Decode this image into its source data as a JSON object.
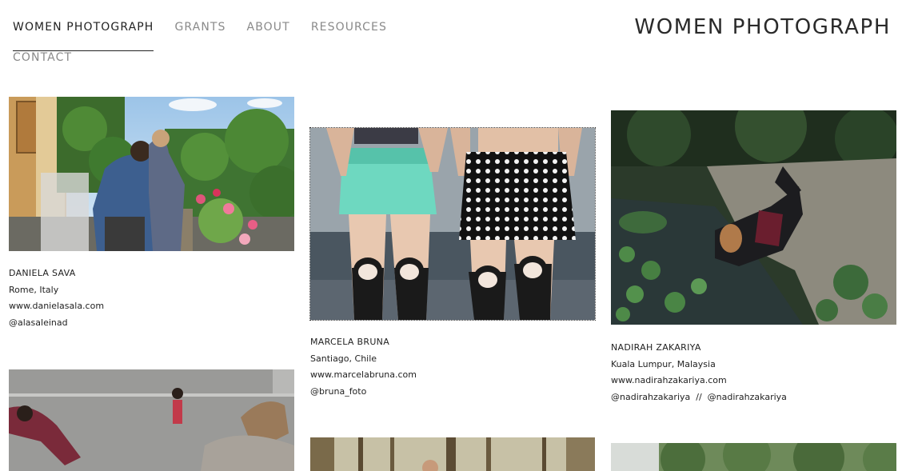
{
  "nav": {
    "items": [
      "WOMEN PHOTOGRAPH",
      "GRANTS",
      "ABOUT",
      "RESOURCES",
      "CONTACT"
    ],
    "active_index": 0
  },
  "site_title": "WOMEN PHOTOGRAPH",
  "photographers": [
    {
      "name": "DANIELA SAVA",
      "location": "Rome, Italy",
      "website": "www.danielasala.com",
      "social": "@alasaleinad"
    },
    {
      "name": "MARCELA BRUNA",
      "location": "Santiago, Chile",
      "website": "www.marcelabruna.com",
      "social": "@bruna_foto"
    },
    {
      "name": "NADIRAH ZAKARIYA",
      "location": "Kuala Lumpur, Malaysia",
      "website": "www.nadirahzakariya.com",
      "social": "@nadirahzakariya  //  @nadirahzakariya"
    }
  ],
  "colors": {
    "nav_inactive": "#8a8a8a",
    "nav_active": "#222222",
    "text": "#222222"
  }
}
